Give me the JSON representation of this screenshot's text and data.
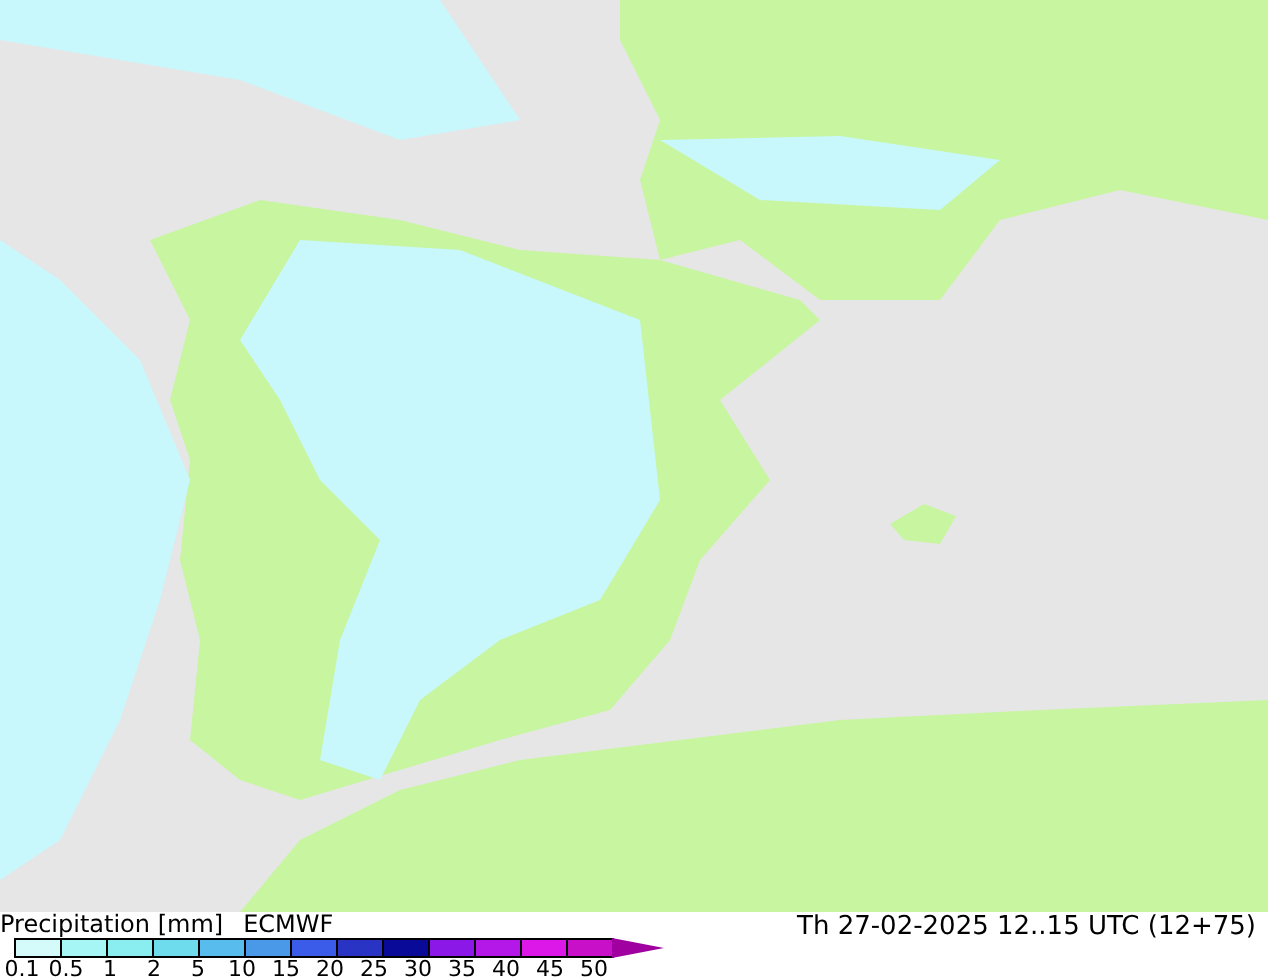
{
  "legend": {
    "title": "Precipitation [mm]",
    "model": "ECMWF",
    "bins": [
      {
        "color": "#d4fafa"
      },
      {
        "color": "#a6f6f6"
      },
      {
        "color": "#8aeef0"
      },
      {
        "color": "#6edcec"
      },
      {
        "color": "#58bcec"
      },
      {
        "color": "#4a98e8"
      },
      {
        "color": "#3a5ce8"
      },
      {
        "color": "#2a34c4"
      },
      {
        "color": "#0a0a98"
      },
      {
        "color": "#8c18e8"
      },
      {
        "color": "#b418e8"
      },
      {
        "color": "#dc18e8"
      },
      {
        "color": "#c810c8"
      },
      {
        "color": "#a000a0",
        "kind": "arrow"
      }
    ],
    "ticks": [
      "0.1",
      "0.5",
      "1",
      "2",
      "5",
      "10",
      "15",
      "20",
      "25",
      "30",
      "35",
      "40",
      "45",
      "50"
    ]
  },
  "valid_time": "Th 27-02-2025 12..15 UTC (12+75)"
}
